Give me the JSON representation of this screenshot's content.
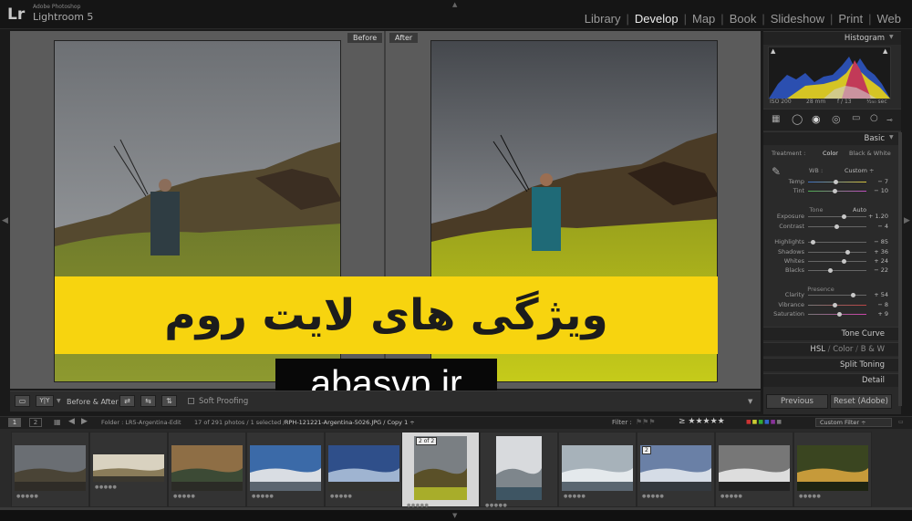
{
  "app": {
    "logo": "Lr",
    "small": "Adobe Photoshop",
    "name": "Lightroom 5"
  },
  "modules": [
    {
      "label": "Library",
      "active": false
    },
    {
      "label": "Develop",
      "active": true
    },
    {
      "label": "Map",
      "active": false
    },
    {
      "label": "Book",
      "active": false
    },
    {
      "label": "Slideshow",
      "active": false
    },
    {
      "label": "Print",
      "active": false
    },
    {
      "label": "Web",
      "active": false
    }
  ],
  "view": {
    "before_label": "Before",
    "after_label": "After"
  },
  "overlay": {
    "banner_text": "ویژگی های لایت روم",
    "watermark": "abasvp.ir"
  },
  "toolbar": {
    "yy_label": "Y|Y",
    "before_after_label": "Before & After :",
    "soft_proofing": "Soft Proofing"
  },
  "histogram": {
    "title": "Histogram",
    "info": {
      "iso": "ISO 200",
      "focal": "28 mm",
      "aperture": "f / 13",
      "shutter": "¹⁄₂₅₀ sec"
    }
  },
  "basic": {
    "title": "Basic",
    "treatment": {
      "label": "Treatment :",
      "color": "Color",
      "bw": "Black & White"
    },
    "wb": {
      "label": "WB :",
      "value": "Custom ÷"
    },
    "tone_label": "Tone",
    "auto_label": "Auto",
    "presence_label": "Presence",
    "sliders": [
      {
        "label": "Temp",
        "value": "− 7",
        "pos": 0.48
      },
      {
        "label": "Tint",
        "value": "− 10",
        "pos": 0.46
      },
      {
        "label": "Exposure",
        "value": "+ 1.20",
        "pos": 0.62
      },
      {
        "label": "Contrast",
        "value": "− 4",
        "pos": 0.49
      },
      {
        "label": "Highlights",
        "value": "− 85",
        "pos": 0.08
      },
      {
        "label": "Shadows",
        "value": "+ 36",
        "pos": 0.68
      },
      {
        "label": "Whites",
        "value": "+ 24",
        "pos": 0.62
      },
      {
        "label": "Blacks",
        "value": "− 22",
        "pos": 0.39
      },
      {
        "label": "Clarity",
        "value": "+ 54",
        "pos": 0.77
      },
      {
        "label": "Vibrance",
        "value": "− 8",
        "pos": 0.46
      },
      {
        "label": "Saturation",
        "value": "+ 9",
        "pos": 0.54
      }
    ]
  },
  "panels": {
    "tone_curve": "Tone Curve",
    "hsl": "HSL",
    "color": "Color",
    "bw": "B & W",
    "split_toning": "Split Toning",
    "detail": "Detail"
  },
  "buttons": {
    "previous": "Previous",
    "reset": "Reset (Adobe)"
  },
  "filmbar": {
    "page1": "1",
    "page2": "2",
    "folder": "Folder : LR5-Argentina-Edit",
    "count": "17 of 291 photos / 1 selected /",
    "filename": "RPH-121221-Argentina-5026.JPG / Copy 1 ÷",
    "filter_label": "Filter :",
    "stars": "≥ ★★★★★",
    "custom_filter": "Custom Filter ÷"
  },
  "thumbs": [
    {
      "id": 1,
      "badge": ""
    },
    {
      "id": 2,
      "badge": ""
    },
    {
      "id": 3,
      "badge": ""
    },
    {
      "id": 4,
      "badge": ""
    },
    {
      "id": 5,
      "badge": ""
    },
    {
      "id": 6,
      "badge": "2 of 2"
    },
    {
      "id": 7,
      "badge": ""
    },
    {
      "id": 8,
      "badge": ""
    },
    {
      "id": 9,
      "badge": "2"
    },
    {
      "id": 10,
      "badge": ""
    },
    {
      "id": 11,
      "badge": ""
    }
  ],
  "colors": {
    "accent": "#f7d40f",
    "panel": "#2a2a2a",
    "workspace": "#5b5b5b"
  },
  "icons": [
    "grid-icon",
    "crop-icon",
    "spot-removal-icon",
    "red-eye-icon",
    "graduated-filter-icon",
    "radial-filter-icon",
    "brush-icon",
    "eyedropper-icon"
  ]
}
